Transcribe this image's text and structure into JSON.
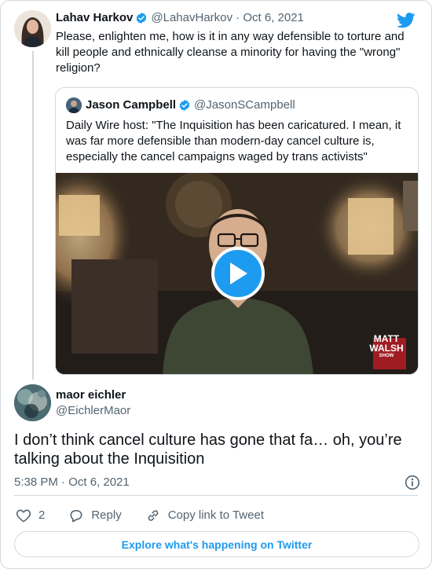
{
  "parent_tweet": {
    "name": "Lahav Harkov",
    "handle_date": "@LahavHarkov · Oct 6, 2021",
    "text": "Please, enlighten me, how is it in any way defensible to torture and kill people and ethnically cleanse a minority for having the \"wrong\" religion?"
  },
  "quoted_tweet": {
    "name": "Jason Campbell",
    "handle": "@JasonSCampbell",
    "text": "Daily Wire host: \"The Inquisition has been caricatured. I mean, it was far more defensible than modern-day cancel culture is, especially the cancel campaigns waged by trans activists\"",
    "video_logo": {
      "line1": "MATT",
      "line2": "WALSH",
      "line3": "SHOW"
    }
  },
  "reply_tweet": {
    "name": "maor eichler",
    "handle": "@EichlerMaor",
    "text": "I don’t think cancel culture has gone that fa… oh, you’re talking about the Inquisition",
    "time_date": "5:38 PM · Oct 6, 2021"
  },
  "actions": {
    "like_count": "2",
    "reply_label": "Reply",
    "copy_label": "Copy link to Tweet"
  },
  "explore_label": "Explore what's happening on Twitter",
  "colors": {
    "accent": "#1d9bf0",
    "secondary_text": "#536471",
    "border": "#cfd9de"
  },
  "icons": [
    "verified-badge-icon",
    "twitter-bird-icon",
    "play-icon",
    "info-icon",
    "heart-icon",
    "reply-bubble-icon",
    "link-icon"
  ]
}
